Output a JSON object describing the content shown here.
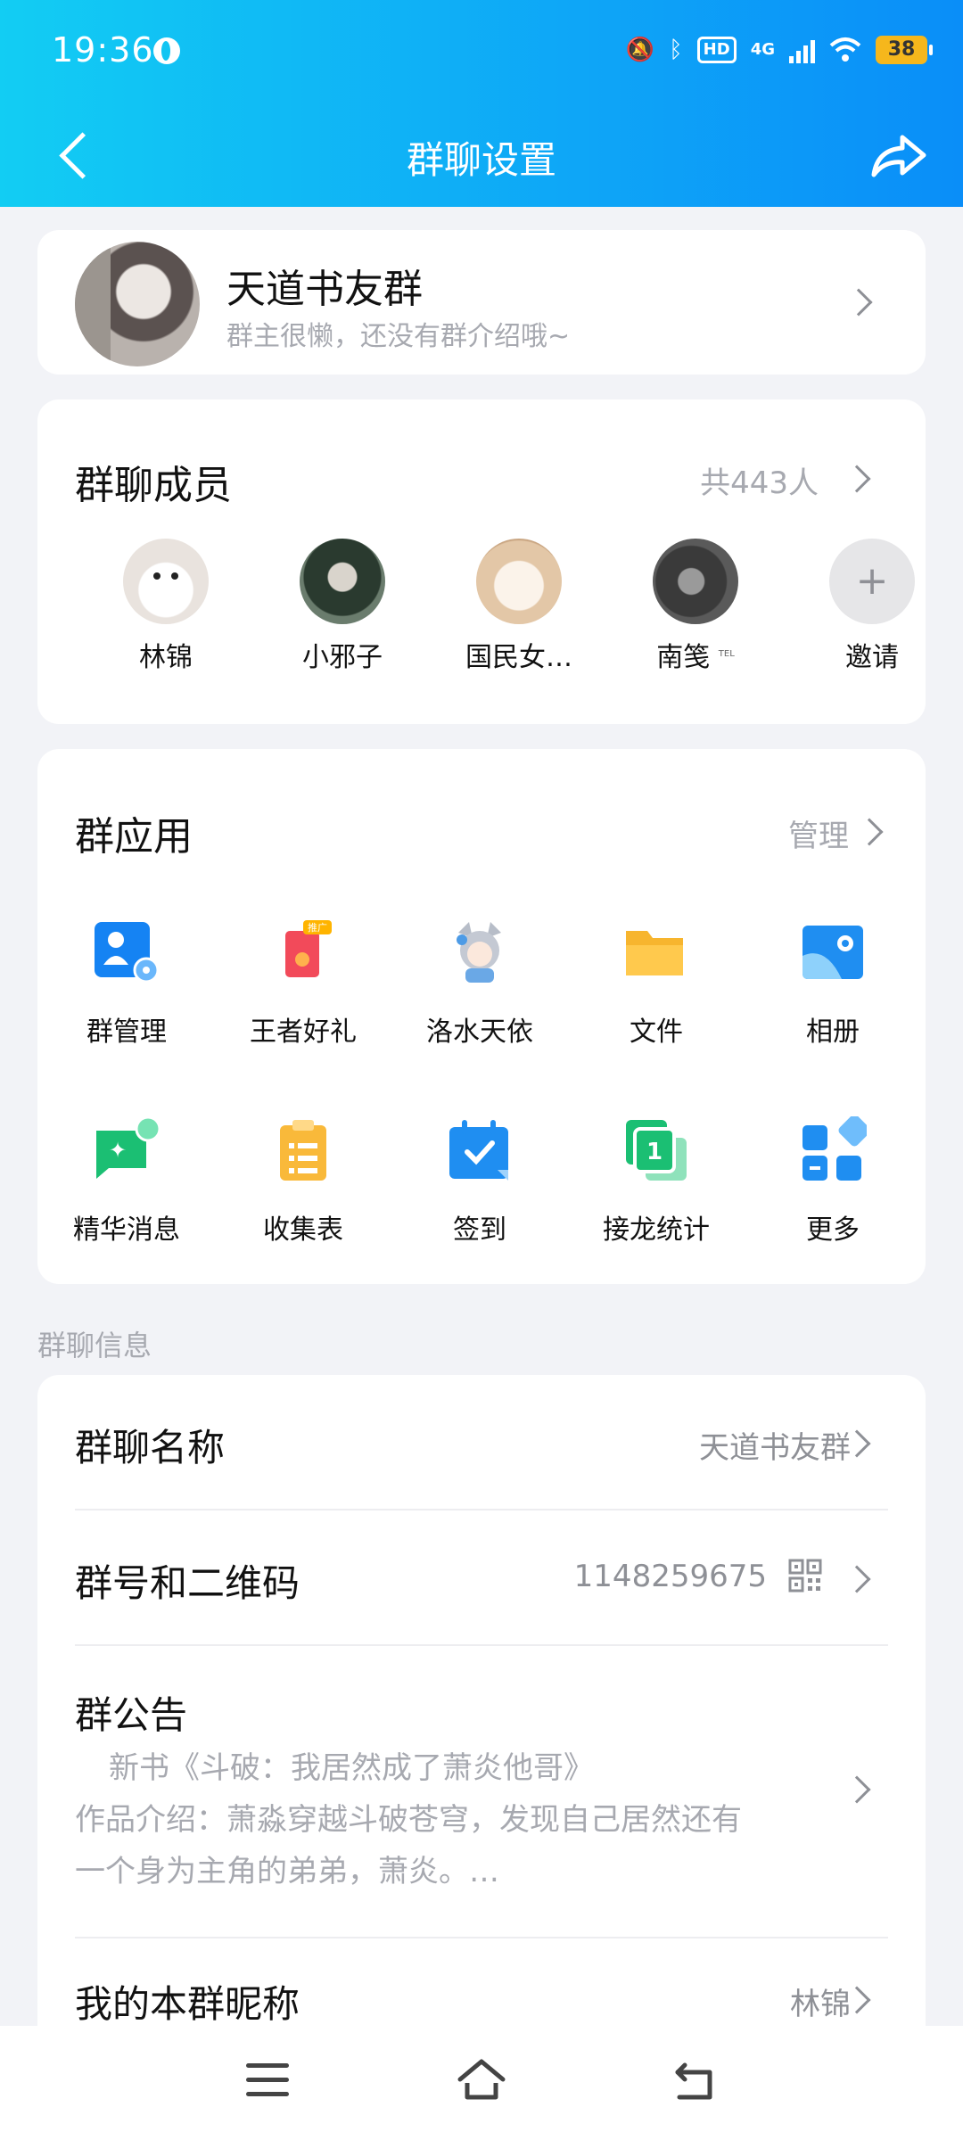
{
  "status_bar": {
    "time": "19:36",
    "network": "4G",
    "hd": "HD",
    "battery": "38"
  },
  "nav": {
    "title": "群聊设置"
  },
  "group": {
    "name": "天道书友群",
    "intro": "群主很懒，还没有群介绍哦~"
  },
  "members": {
    "title": "群聊成员",
    "count": "共443人",
    "list": [
      {
        "name": "林锦"
      },
      {
        "name": "小邪子"
      },
      {
        "name": "国民女…"
      },
      {
        "name": "南笺",
        "badge": "TEL"
      }
    ],
    "invite_label": "邀请"
  },
  "apps": {
    "title": "群应用",
    "manage_label": "管理",
    "items": [
      {
        "label": "群管理",
        "icon": "group-admin-icon"
      },
      {
        "label": "王者好礼",
        "icon": "gift-icon",
        "badge": "推广"
      },
      {
        "label": "洛水天依",
        "icon": "character-avatar-icon"
      },
      {
        "label": "文件",
        "icon": "folder-icon"
      },
      {
        "label": "相册",
        "icon": "album-icon"
      },
      {
        "label": "精华消息",
        "icon": "essence-message-icon"
      },
      {
        "label": "收集表",
        "icon": "form-icon"
      },
      {
        "label": "签到",
        "icon": "check-in-calendar-icon"
      },
      {
        "label": "接龙统计",
        "icon": "relay-icon"
      },
      {
        "label": "更多",
        "icon": "more-grid-icon"
      }
    ]
  },
  "info": {
    "section_label": "群聊信息",
    "name_title": "群聊名称",
    "name_value": "天道书友群",
    "number_title": "群号和二维码",
    "number_value": "1148259675",
    "notice_title": "群公告",
    "notice_line1": "新书《斗破：我居然成了萧炎他哥》",
    "notice_line2": "作品介绍：萧淼穿越斗破苍穹，发现自己居然还有",
    "notice_line3": "一个身为主角的弟弟，萧炎。…",
    "nickname_title": "我的本群昵称",
    "nickname_value": "林锦"
  },
  "colors": {
    "header_start": "#12cdf3",
    "header_end": "#0a8ef8",
    "background": "#f2f3f7",
    "muted_text": "#a7a9b0"
  }
}
